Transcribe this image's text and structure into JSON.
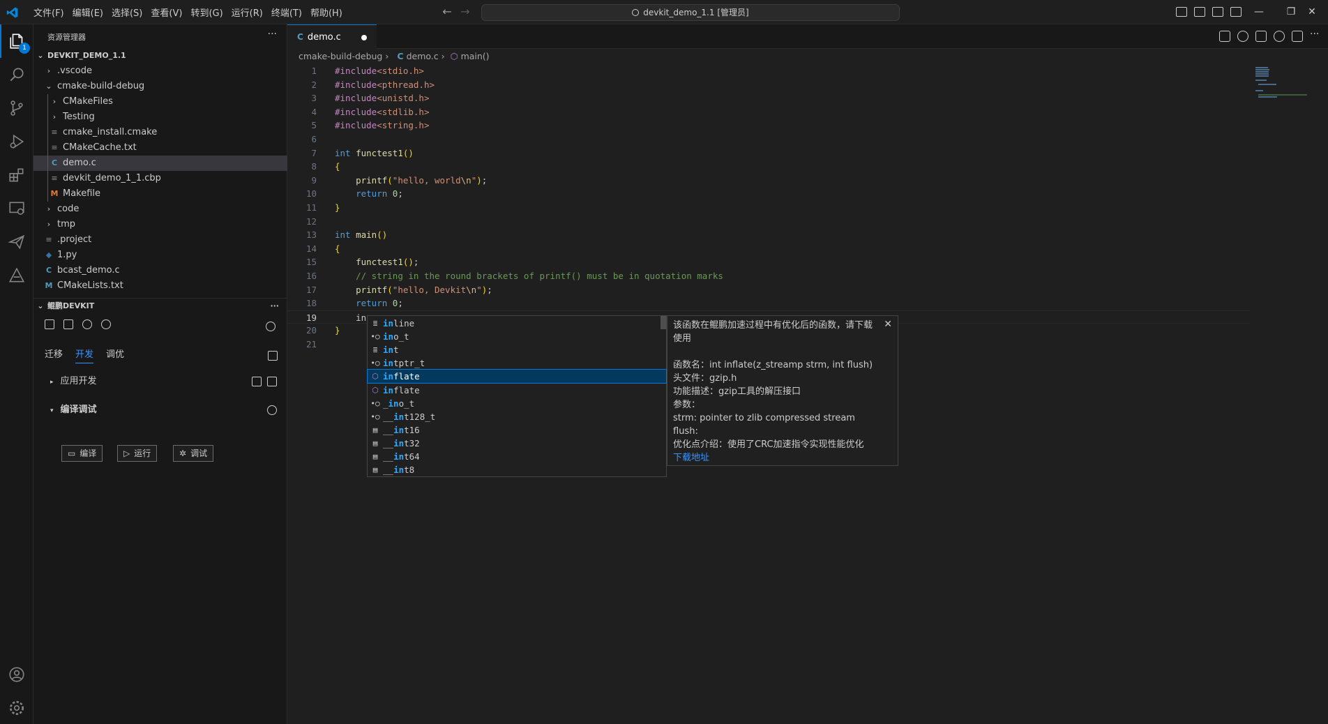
{
  "window": {
    "title": "devkit_demo_1.1 [管理员]",
    "menu": [
      "文件(F)",
      "编辑(E)",
      "选择(S)",
      "查看(V)",
      "转到(G)",
      "运行(R)",
      "终端(T)",
      "帮助(H)"
    ],
    "window_controls": [
      "—",
      "❐",
      "✕"
    ]
  },
  "activity_bar": {
    "explorer_badge": "1",
    "items": [
      "explorer-icon",
      "search-icon",
      "source-control-icon",
      "run-debug-icon",
      "extensions-icon",
      "remote-explorer-icon",
      "send-icon",
      "devkit-icon",
      "account-icon",
      "settings-gear-icon"
    ]
  },
  "sidebar": {
    "title": "资源管理器",
    "more": "···",
    "root": "DEVKIT_DEMO_1.1",
    "tree": [
      {
        "label": ".vscode",
        "type": "folder"
      },
      {
        "label": "cmake-build-debug",
        "type": "folder-open"
      },
      {
        "label": "CMakeFiles",
        "type": "folder"
      },
      {
        "label": "Testing",
        "type": "folder"
      },
      {
        "label": "cmake_install.cmake",
        "type": "file"
      },
      {
        "label": "CMakeCache.txt",
        "type": "file"
      },
      {
        "label": "demo.c",
        "type": "c",
        "selected": true
      },
      {
        "label": "devkit_demo_1_1.cbp",
        "type": "file"
      },
      {
        "label": "Makefile",
        "type": "makefile"
      },
      {
        "label": "code",
        "type": "folder"
      },
      {
        "label": "tmp",
        "type": "folder"
      },
      {
        "label": ".project",
        "type": "file"
      },
      {
        "label": "1.py",
        "type": "python"
      },
      {
        "label": "bcast_demo.c",
        "type": "c"
      },
      {
        "label": "CMakeLists.txt",
        "type": "cmake"
      }
    ],
    "devkit_section": "鲲鹏DEVKIT",
    "devkit_tabs": [
      "迁移",
      "开发",
      "调优"
    ],
    "devkit_active_tab": "开发",
    "app_dev": "应用开发",
    "compile_debug": "编译调试",
    "buttons": [
      "编译",
      "运行",
      "调试"
    ]
  },
  "editor": {
    "tab": {
      "label": "demo.c",
      "modified": true
    },
    "breadcrumb": [
      "cmake-build-debug",
      "demo.c",
      "main()"
    ],
    "current_line": 19,
    "lines": [
      "#include<stdio.h>",
      "#include<pthread.h>",
      "#include<unistd.h>",
      "#include<stdlib.h>",
      "#include<string.h>",
      "",
      "int functest1()",
      "{",
      "    printf(\"hello, world\\n\");",
      "    return 0;",
      "}",
      "",
      "int main()",
      "{",
      "    functest1();",
      "    // string in the round brackets of printf() must be in quotation marks",
      "    printf(\"hello, Devkit\\n\");",
      "    return 0;",
      "    in",
      "}",
      ""
    ]
  },
  "suggest": {
    "items": [
      {
        "label": "inline",
        "icon": "keyword"
      },
      {
        "label": "ino_t",
        "icon": "typedef"
      },
      {
        "label": "int",
        "icon": "keyword"
      },
      {
        "label": "intptr_t",
        "icon": "typedef"
      },
      {
        "label": "inflate",
        "icon": "function",
        "selected": true
      },
      {
        "label": "inflate",
        "icon": "function"
      },
      {
        "label": "_ino_t",
        "icon": "typedef"
      },
      {
        "label": "__int128_t",
        "icon": "typedef"
      },
      {
        "label": "__int16",
        "icon": "keyword-box"
      },
      {
        "label": "__int32",
        "icon": "keyword-box"
      },
      {
        "label": "__int64",
        "icon": "keyword-box"
      },
      {
        "label": "__int8",
        "icon": "keyword-box"
      }
    ],
    "details": {
      "intro": "该函数在鲲鹏加速过程中有优化后的函数，请下载使用",
      "signature": "函数名：int inflate(z_streamp strm, int flush)",
      "header": "头文件：gzip.h",
      "desc": "功能描述：gzip工具的解压接口",
      "params_label": "参数：",
      "param1": "strm: pointer to zlib compressed stream",
      "param2": "flush:",
      "optimization": "优化点介绍：使用了CRC加速指令实现性能优化",
      "download_link": "下载地址",
      "close": "✕"
    }
  },
  "colors": {
    "accent": "#0078d4",
    "editor_bg": "#1f1f1f",
    "sidebar_bg": "#181818",
    "suggest_selected": "#04395e"
  }
}
